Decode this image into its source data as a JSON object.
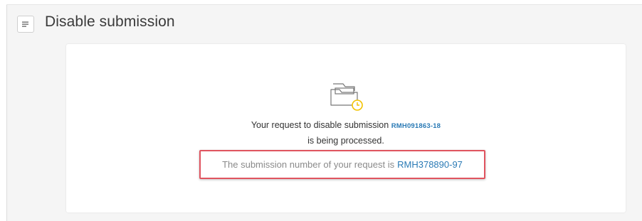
{
  "header": {
    "title": "Disable submission",
    "menu_icon": "menu-icon"
  },
  "confirmation": {
    "icon": "folder-clock-icon",
    "line1_prefix": "Your request to disable submission",
    "disabled_submission_id": "RMH091863-18",
    "line2": "is being processed.",
    "request_text": "The submission number of your request is",
    "request_submission_id": "RMH378890-97"
  },
  "colors": {
    "link": "#2a7ab5",
    "highlight_border": "#e0545f",
    "icon_accent": "#f2c200",
    "panel_bg": "#f5f5f5"
  }
}
